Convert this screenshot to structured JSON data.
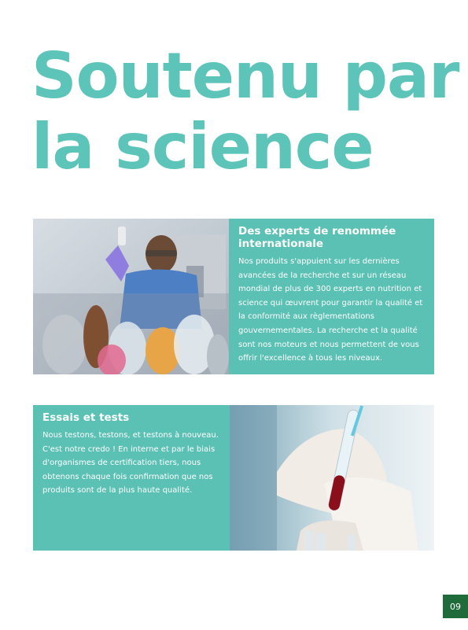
{
  "headline": {
    "line1": "Soutenu par",
    "line2": "la science"
  },
  "section_experts": {
    "title": "Des experts de renommée internationale",
    "body": "Nos produits s'appuient sur les dernières avancées de la recherche et sur un réseau mondial de plus de 300 experts en nutrition et science qui œuvrent pour garantir la qualité et la conformité aux règlementations gouvernementales. La recherche et la qualité sont nos moteurs et nous permettent de vous offrir l'excellence à tous les niveaux."
  },
  "section_tests": {
    "title": "Essais et tests",
    "body": "Nous testons, testons, et testons à nouveau. C'est notre credo ! En interne et par le biais d'organismes de certification tiers, nous obtenons chaque fois confirmation que nos produits sont de la plus haute qualité."
  },
  "page_number": "09",
  "colors": {
    "accent": "#5cc4b8",
    "panel": "#5bc1b5",
    "page_badge": "#1f6b3a"
  }
}
